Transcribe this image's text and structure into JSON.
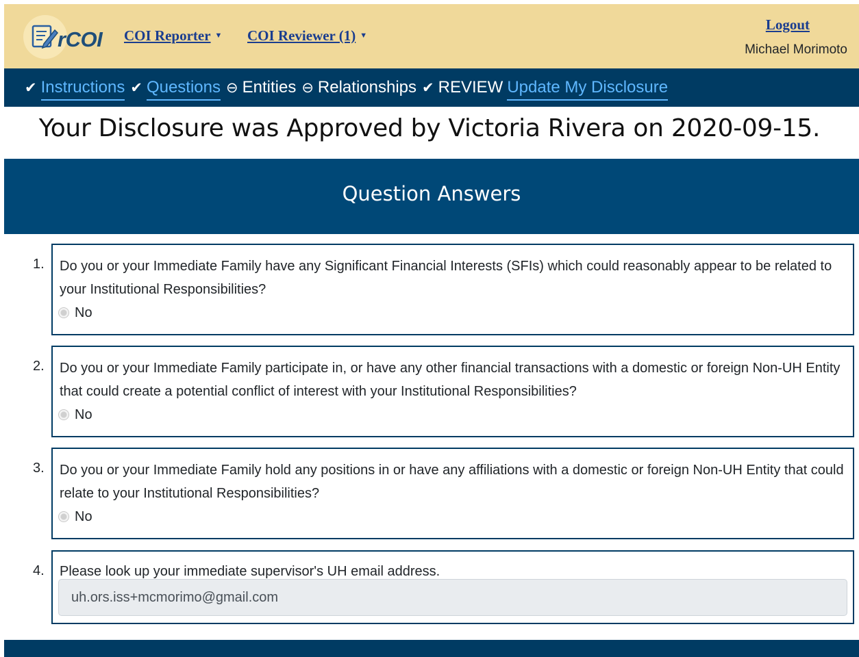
{
  "header": {
    "logo_text": "rCOI",
    "menus": [
      {
        "label": "COI Reporter"
      },
      {
        "label": "COI Reviewer (1)"
      }
    ],
    "logout_label": "Logout",
    "user_name": "Michael Morimoto"
  },
  "steps": [
    {
      "icon": "check-icon",
      "label": "Instructions",
      "link": true
    },
    {
      "icon": "check-icon",
      "label": "Questions",
      "link": true
    },
    {
      "icon": "minus-circle-icon",
      "label": "Entities",
      "link": false
    },
    {
      "icon": "minus-circle-icon",
      "label": "Relationships",
      "link": false
    },
    {
      "icon": "check-icon",
      "label": "REVIEW",
      "link": false
    },
    {
      "icon": "",
      "label": "Update My Disclosure",
      "link": true
    }
  ],
  "approval_message": "Your Disclosure was Approved by Victoria Rivera on 2020-09-15.",
  "section_title": "Question Answers",
  "questions": [
    {
      "number": "1.",
      "text": "Do you or your Immediate Family have any Significant Financial Interests (SFIs) which could reasonably appear to be related to your Institutional Responsibilities?",
      "answer": "No"
    },
    {
      "number": "2.",
      "text": "Do you or your Immediate Family participate in, or have any other financial transactions with a domestic or foreign Non-UH Entity that could create a potential conflict of interest with your Institutional Responsibilities?",
      "answer": "No"
    },
    {
      "number": "3.",
      "text": "Do you or your Immediate Family hold any positions in or have any affiliations with a domestic or foreign Non-UH Entity that could relate to your Institutional Responsibilities?",
      "answer": "No"
    },
    {
      "number": "4.",
      "text": "Please look up your immediate supervisor's UH email address.",
      "input_value": "uh.ors.iss+mcmorimo@gmail.com"
    }
  ],
  "colors": {
    "header_bg": "#f0d99a",
    "nav_bg": "#003b63",
    "banner_bg": "#004877",
    "link_blue": "#1a3d8f",
    "step_link": "#5fb7ff"
  }
}
